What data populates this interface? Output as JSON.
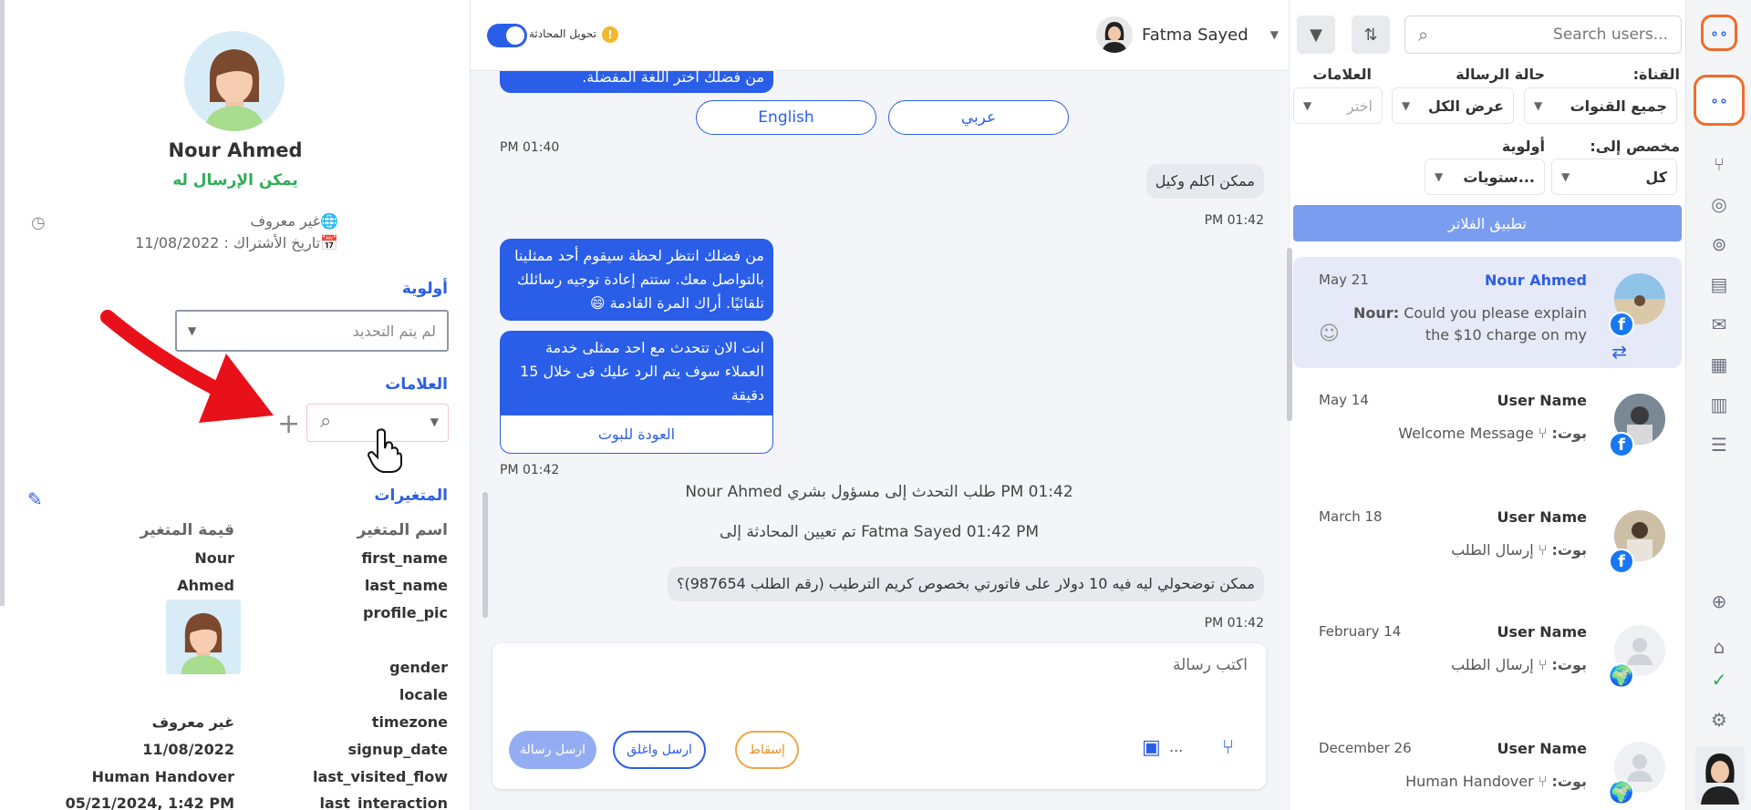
{
  "rail": {
    "icons": [
      "logo-icon",
      "logo-icon-active",
      "flow-icon",
      "bot-head-icon",
      "broadcast-icon",
      "contacts-icon",
      "mail-icon",
      "templates-icon",
      "analytics-icon",
      "tasks-icon",
      "globe-icon",
      "lock-icon",
      "check-icon",
      "gear-icon"
    ]
  },
  "list": {
    "search_placeholder": "Search users...",
    "filters": {
      "channel_label": "القناة:",
      "channel_value": "جميع القنوات",
      "status_label": "حالة الرسالة",
      "status_value": "عرض الكل",
      "tags_label": "العلامات",
      "tags_placeholder": "اختر",
      "assigned_label": "مخصص إلى:",
      "assigned_value": "كل",
      "priority_label": "أولوية",
      "priority_value": "...ستويات",
      "apply": "تطبيق الفلاتر"
    },
    "conversations": [
      {
        "name": "Nour Ahmed",
        "date": "May 21",
        "preview_sender": "Nour:",
        "preview": "Could you please explain the $10 charge on my statement",
        "channel": "facebook"
      },
      {
        "name": "User Name",
        "date": "May 14",
        "preview_sender": "بوت:",
        "preview": "Welcome Message",
        "channel": "facebook"
      },
      {
        "name": "User Name",
        "date": "March 18",
        "preview_sender": "بوت:",
        "preview": "إرسال الطلب",
        "channel": "facebook"
      },
      {
        "name": "User Name",
        "date": "February 14",
        "preview_sender": "بوت:",
        "preview": "إرسال الطلب",
        "channel": "web"
      },
      {
        "name": "User Name",
        "date": "December 26",
        "preview_sender": "بوت:",
        "preview": "Human Handover",
        "channel": "web"
      }
    ]
  },
  "chat": {
    "toggle_label": "تحويل المحادثة",
    "info_icon": "!",
    "agent_name": "Fatma Sayed",
    "messages": {
      "top_bot_partial": "من فضلك اختر اللغة المفضلة.",
      "lang_en": "English",
      "lang_ar": "عربي",
      "ts1": "PM 01:40",
      "user1": "ممكن اكلم وكيل",
      "ts2": "PM 01:42",
      "bot1": "من فضلك انتظر لحظة سيقوم أحد ممثلينا بالتواصل معك. ستتم إعادة توجيه رسائلك تلقائيًا. أراك المرة القادمة 😄",
      "bot2": "انت الان تتحدث مع احد ممثلى خدمة العملاء سوف يتم الرد عليك فى خلال 15 دقيقة",
      "back_to_bot": "العودة للبوت",
      "ts3": "PM 01:42",
      "sys1": "Nour Ahmed طلب التحدث إلى مسؤول بشري PM 01:42",
      "sys2": "تم تعيين المحادثة إلى Fatma Sayed 01:42 PM",
      "user2": "ممكن توضحولي ليه فيه 10 دولار على فاتورتي بخصوص كريم الترطيب (رقم الطلب 987654)؟",
      "ts4": "PM 01:42"
    },
    "composer": {
      "placeholder": "اكتب رسالة",
      "send": "ارسل رسالة",
      "send_close": "ارسل واغلق",
      "drop": "إسقاط",
      "more": "..."
    }
  },
  "details": {
    "name": "Nour Ahmed",
    "status": "يمكن الإرسال له",
    "location": "غير معروف",
    "subscribed": "تاريخ الأشتراك : 11/08/2022",
    "priority_title": "أولوية",
    "priority_value": "لم يتم التحديد",
    "tags_title": "العلامات",
    "variables_title": "المتغيرات",
    "var_name_header": "اسم المتغير",
    "var_value_header": "قيمة المتغير",
    "variables": [
      {
        "key": "first_name",
        "value": "Nour"
      },
      {
        "key": "last_name",
        "value": "Ahmed"
      },
      {
        "key": "profile_pic",
        "value": ""
      },
      {
        "key": "gender",
        "value": ""
      },
      {
        "key": "locale",
        "value": ""
      },
      {
        "key": "timezone",
        "value": "غير معروف"
      },
      {
        "key": "signup_date",
        "value": "11/08/2022"
      },
      {
        "key": "last_visited_flow",
        "value": "Human Handover"
      },
      {
        "key": "last_interaction",
        "value": "05/21/2024, 1:42 PM"
      }
    ]
  },
  "colors": {
    "accent": "#2a5ee8",
    "brand_orange": "#f26b2a",
    "success": "#2eae58",
    "annotation_arrow": "#e8111a"
  }
}
